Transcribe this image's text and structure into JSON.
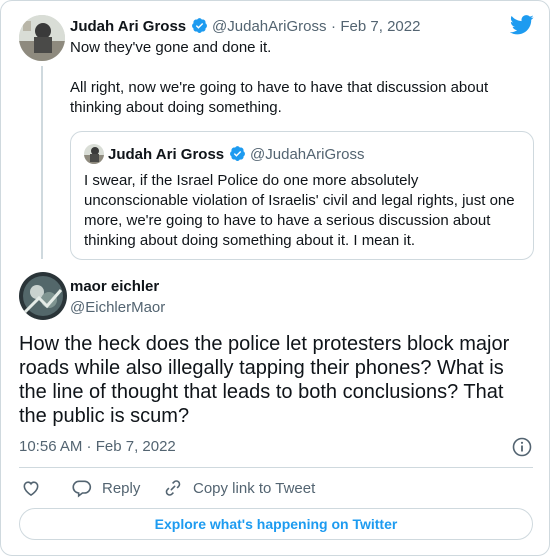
{
  "parent_tweet": {
    "author_name": "Judah Ari Gross",
    "author_handle": "@JudahAriGross",
    "separator": "·",
    "date": "Feb 7, 2022",
    "text_lines": [
      "Now they've gone and done it.",
      "All right, now we're going to have to have that discussion about thinking about doing something."
    ]
  },
  "quoted_tweet": {
    "author_name": "Judah Ari Gross",
    "author_handle": "@JudahAriGross",
    "text": "I swear, if the Israel Police do one more absolutely unconscionable violation of Israelis' civil and legal rights, just one more, we're going to have to have a serious discussion about thinking about doing something about it. I mean it."
  },
  "main_tweet": {
    "author_name": "maor eichler",
    "author_handle": "@EichlerMaor",
    "text": "How the heck does the police let protesters block major roads while also illegally tapping their phones? What is the line of thought that leads to both conclusions? That the public is scum?",
    "timestamp": "10:56 AM · Feb 7, 2022"
  },
  "actions": {
    "reply_label": "Reply",
    "copy_link_label": "Copy link to Tweet"
  },
  "explore_label": "Explore what's happening on Twitter",
  "colors": {
    "accent": "#1d9bf0",
    "text_primary": "#0f1419",
    "text_secondary": "#536471",
    "border": "#cfd9de"
  },
  "icons": [
    "twitter-bird-icon",
    "verified-badge-icon",
    "info-icon",
    "heart-icon",
    "reply-icon",
    "link-icon"
  ]
}
